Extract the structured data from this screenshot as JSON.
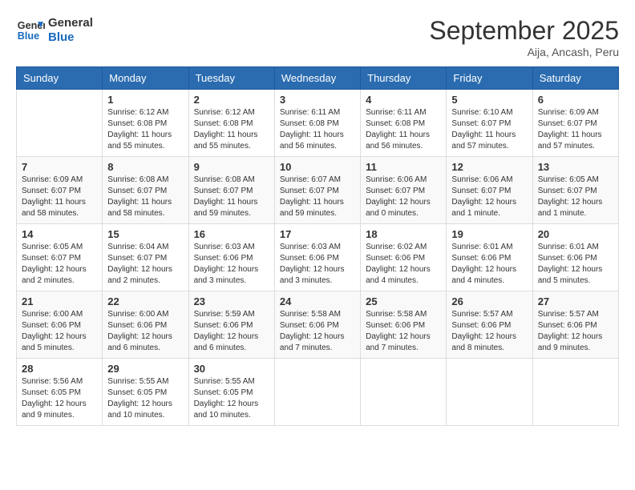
{
  "logo": {
    "line1": "General",
    "line2": "Blue"
  },
  "title": "September 2025",
  "location": "Aija, Ancash, Peru",
  "days_of_week": [
    "Sunday",
    "Monday",
    "Tuesday",
    "Wednesday",
    "Thursday",
    "Friday",
    "Saturday"
  ],
  "weeks": [
    [
      {
        "day": "",
        "info": ""
      },
      {
        "day": "1",
        "info": "Sunrise: 6:12 AM\nSunset: 6:08 PM\nDaylight: 11 hours\nand 55 minutes."
      },
      {
        "day": "2",
        "info": "Sunrise: 6:12 AM\nSunset: 6:08 PM\nDaylight: 11 hours\nand 55 minutes."
      },
      {
        "day": "3",
        "info": "Sunrise: 6:11 AM\nSunset: 6:08 PM\nDaylight: 11 hours\nand 56 minutes."
      },
      {
        "day": "4",
        "info": "Sunrise: 6:11 AM\nSunset: 6:08 PM\nDaylight: 11 hours\nand 56 minutes."
      },
      {
        "day": "5",
        "info": "Sunrise: 6:10 AM\nSunset: 6:07 PM\nDaylight: 11 hours\nand 57 minutes."
      },
      {
        "day": "6",
        "info": "Sunrise: 6:09 AM\nSunset: 6:07 PM\nDaylight: 11 hours\nand 57 minutes."
      }
    ],
    [
      {
        "day": "7",
        "info": "Sunrise: 6:09 AM\nSunset: 6:07 PM\nDaylight: 11 hours\nand 58 minutes."
      },
      {
        "day": "8",
        "info": "Sunrise: 6:08 AM\nSunset: 6:07 PM\nDaylight: 11 hours\nand 58 minutes."
      },
      {
        "day": "9",
        "info": "Sunrise: 6:08 AM\nSunset: 6:07 PM\nDaylight: 11 hours\nand 59 minutes."
      },
      {
        "day": "10",
        "info": "Sunrise: 6:07 AM\nSunset: 6:07 PM\nDaylight: 11 hours\nand 59 minutes."
      },
      {
        "day": "11",
        "info": "Sunrise: 6:06 AM\nSunset: 6:07 PM\nDaylight: 12 hours\nand 0 minutes."
      },
      {
        "day": "12",
        "info": "Sunrise: 6:06 AM\nSunset: 6:07 PM\nDaylight: 12 hours\nand 1 minute."
      },
      {
        "day": "13",
        "info": "Sunrise: 6:05 AM\nSunset: 6:07 PM\nDaylight: 12 hours\nand 1 minute."
      }
    ],
    [
      {
        "day": "14",
        "info": "Sunrise: 6:05 AM\nSunset: 6:07 PM\nDaylight: 12 hours\nand 2 minutes."
      },
      {
        "day": "15",
        "info": "Sunrise: 6:04 AM\nSunset: 6:07 PM\nDaylight: 12 hours\nand 2 minutes."
      },
      {
        "day": "16",
        "info": "Sunrise: 6:03 AM\nSunset: 6:06 PM\nDaylight: 12 hours\nand 3 minutes."
      },
      {
        "day": "17",
        "info": "Sunrise: 6:03 AM\nSunset: 6:06 PM\nDaylight: 12 hours\nand 3 minutes."
      },
      {
        "day": "18",
        "info": "Sunrise: 6:02 AM\nSunset: 6:06 PM\nDaylight: 12 hours\nand 4 minutes."
      },
      {
        "day": "19",
        "info": "Sunrise: 6:01 AM\nSunset: 6:06 PM\nDaylight: 12 hours\nand 4 minutes."
      },
      {
        "day": "20",
        "info": "Sunrise: 6:01 AM\nSunset: 6:06 PM\nDaylight: 12 hours\nand 5 minutes."
      }
    ],
    [
      {
        "day": "21",
        "info": "Sunrise: 6:00 AM\nSunset: 6:06 PM\nDaylight: 12 hours\nand 5 minutes."
      },
      {
        "day": "22",
        "info": "Sunrise: 6:00 AM\nSunset: 6:06 PM\nDaylight: 12 hours\nand 6 minutes."
      },
      {
        "day": "23",
        "info": "Sunrise: 5:59 AM\nSunset: 6:06 PM\nDaylight: 12 hours\nand 6 minutes."
      },
      {
        "day": "24",
        "info": "Sunrise: 5:58 AM\nSunset: 6:06 PM\nDaylight: 12 hours\nand 7 minutes."
      },
      {
        "day": "25",
        "info": "Sunrise: 5:58 AM\nSunset: 6:06 PM\nDaylight: 12 hours\nand 7 minutes."
      },
      {
        "day": "26",
        "info": "Sunrise: 5:57 AM\nSunset: 6:06 PM\nDaylight: 12 hours\nand 8 minutes."
      },
      {
        "day": "27",
        "info": "Sunrise: 5:57 AM\nSunset: 6:06 PM\nDaylight: 12 hours\nand 9 minutes."
      }
    ],
    [
      {
        "day": "28",
        "info": "Sunrise: 5:56 AM\nSunset: 6:05 PM\nDaylight: 12 hours\nand 9 minutes."
      },
      {
        "day": "29",
        "info": "Sunrise: 5:55 AM\nSunset: 6:05 PM\nDaylight: 12 hours\nand 10 minutes."
      },
      {
        "day": "30",
        "info": "Sunrise: 5:55 AM\nSunset: 6:05 PM\nDaylight: 12 hours\nand 10 minutes."
      },
      {
        "day": "",
        "info": ""
      },
      {
        "day": "",
        "info": ""
      },
      {
        "day": "",
        "info": ""
      },
      {
        "day": "",
        "info": ""
      }
    ]
  ]
}
